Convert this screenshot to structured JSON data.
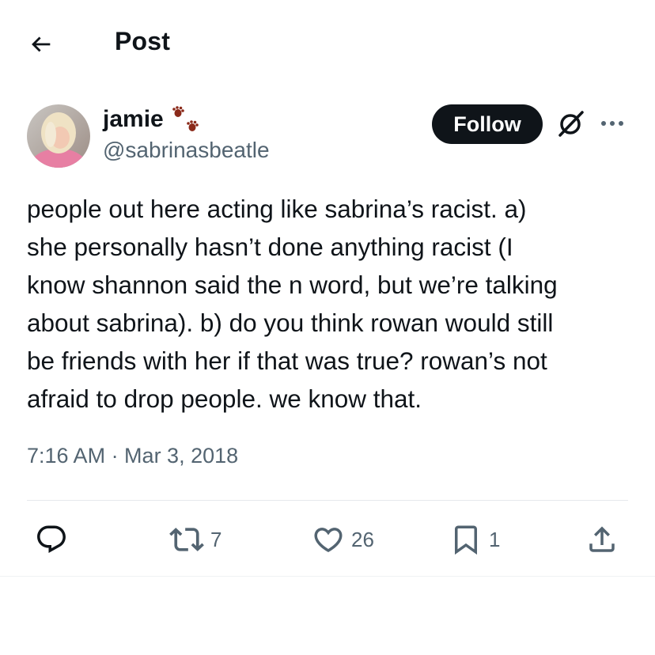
{
  "header": {
    "title": "Post",
    "back_icon": "arrow-left-icon"
  },
  "author": {
    "display_name": "jamie",
    "name_emoji": "paw-prints-icon",
    "handle": "@sabrinasbeatle",
    "follow_label": "Follow"
  },
  "tweet": {
    "text": "people out here acting like sabrina’s racist. a)\nshe personally hasn’t done anything racist (I\nknow shannon said the n word, but we’re talking\nabout sabrina). b) do you think rowan would still\nbe friends with her if that was true? rowan’s not\nafraid to drop people. we know that.",
    "timestamp": "7:16 AM · Mar 3, 2018"
  },
  "actions": {
    "reply_icon": "reply-icon",
    "retweet_icon": "retweet-icon",
    "retweet_count": "7",
    "like_icon": "heart-icon",
    "like_count": "26",
    "bookmark_icon": "bookmark-icon",
    "bookmark_count": "1",
    "share_icon": "share-icon"
  },
  "colors": {
    "text": "#0f1419",
    "secondary": "#536471",
    "follow_bg": "#0f1419",
    "paw": "#8b2a1a"
  }
}
